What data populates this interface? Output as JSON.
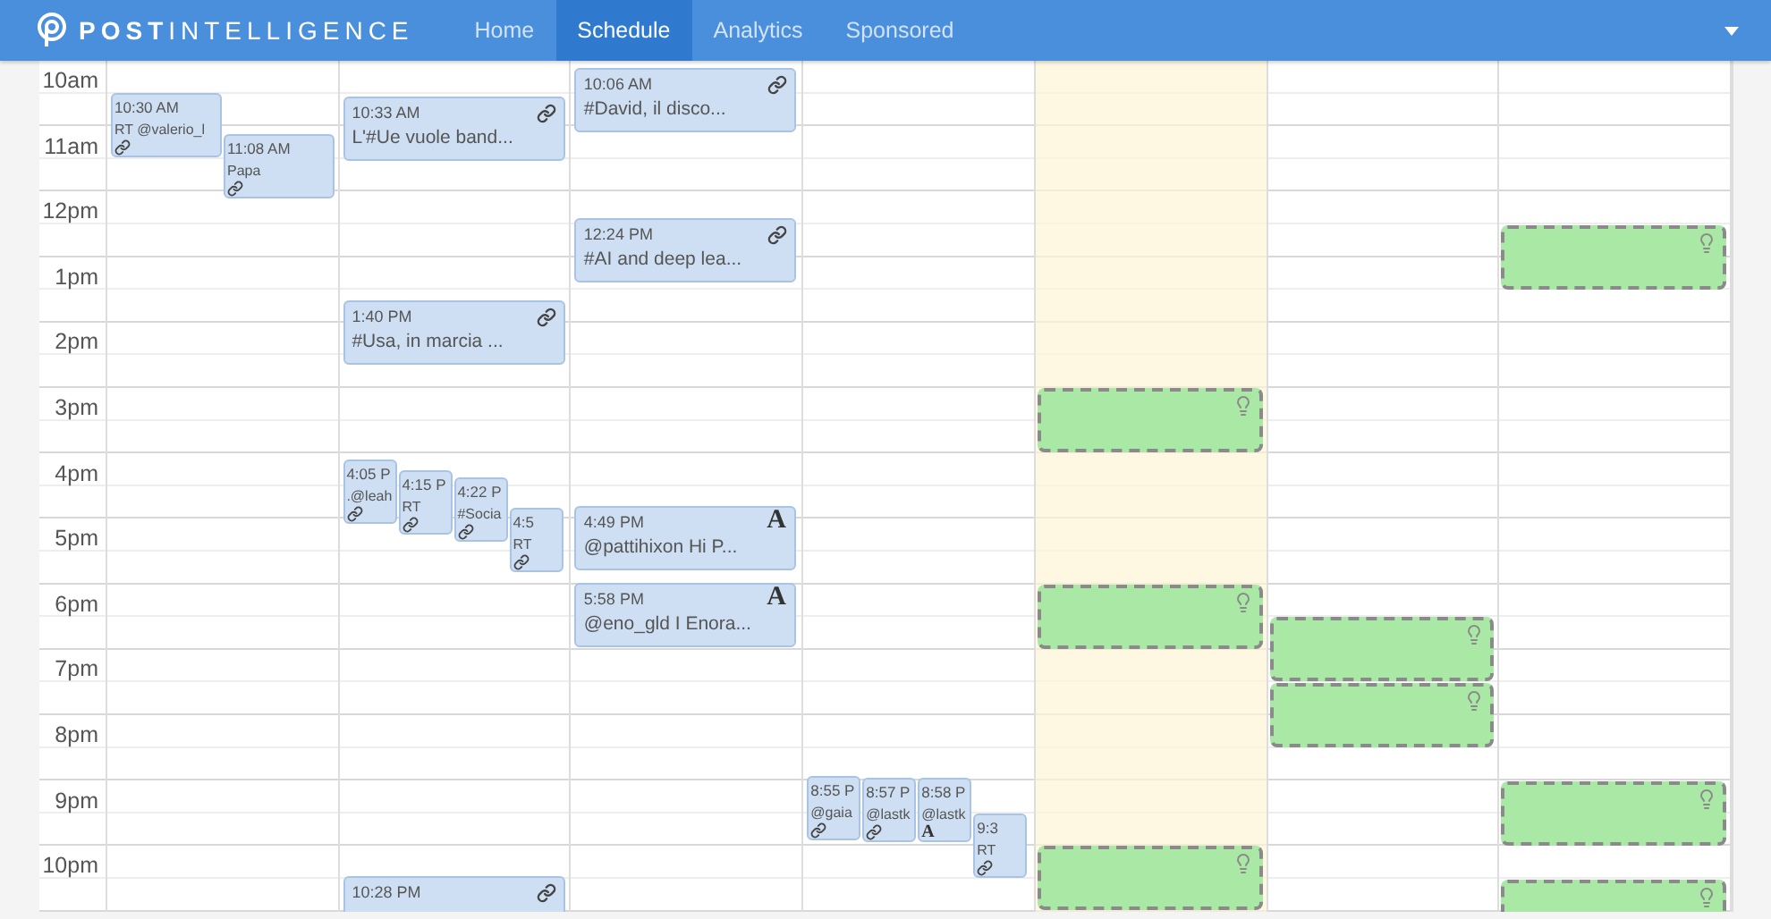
{
  "navbar": {
    "logo": "**POST**INTELLIGENCE",
    "items": [
      {
        "label": "Home",
        "selected": false
      },
      {
        "label": "Schedule",
        "selected": true
      },
      {
        "label": "Analytics",
        "selected": false
      },
      {
        "label": "Sponsored",
        "selected": false
      }
    ]
  },
  "days": [
    {
      "today": false
    },
    {
      "today": false
    },
    {
      "today": false
    },
    {
      "today": false
    },
    {
      "today": true
    },
    {
      "today": false
    },
    {
      "today": false
    }
  ],
  "rows": [
    {
      "label": "10am",
      "cells": [
        {
          "events": [
            {
              "time": "10:30 AM",
              "text": "RT @valerio_l",
              "kind": "link"
            }
          ]
        },
        {
          "events": [
            {
              "time": "10:33 AM",
              "text": "L'#Ue vuole band...",
              "kind": "link"
            }
          ]
        },
        {
          "events": [
            {
              "time": "10:06 AM",
              "text": "#David, il disco...",
              "kind": "link"
            }
          ]
        },
        {},
        {},
        {},
        {}
      ]
    },
    {
      "label": "11am",
      "cells": [
        {
          "events": [
            {
              "time": "11:08 AM",
              "text": "Papa",
              "kind": "link"
            }
          ]
        },
        {},
        {},
        {},
        {},
        {},
        {}
      ]
    },
    {
      "label": "12pm",
      "cells": [
        {},
        {},
        {
          "events": [
            {
              "time": "12:24 PM",
              "text": "#AI and deep lea...",
              "kind": "link"
            }
          ]
        },
        {},
        {},
        {},
        {
          "suggested": true,
          "half_past": true
        }
      ]
    },
    {
      "label": "1pm",
      "cells": [
        {},
        {
          "events": [
            {
              "time": "1:40 PM",
              "text": "#Usa, in marcia ...",
              "kind": "link"
            }
          ]
        },
        {},
        {},
        {},
        {},
        {}
      ]
    },
    {
      "label": "2pm",
      "cells": [
        {},
        {},
        {},
        {},
        {},
        {},
        {}
      ]
    },
    {
      "label": "3pm",
      "cells": [
        {},
        {},
        {},
        {},
        {
          "suggested": true,
          "half_past": false
        },
        {},
        {}
      ]
    },
    {
      "label": "4pm",
      "cells": [
        {},
        {
          "events": [
            {
              "time": "4:05 P",
              "text": ".@leah",
              "kind": "link"
            },
            {
              "time": "4:15 P",
              "text": "RT",
              "kind": "link"
            },
            {
              "time": "4:22 P",
              "text": "#Socia",
              "kind": "link"
            },
            {
              "time": "4:5",
              "text": "RT",
              "kind": "link"
            }
          ]
        },
        {
          "events": [
            {
              "time": "4:49 PM",
              "text": "@pattihixon Hi P...",
              "kind": "font",
              "glyph": "A"
            }
          ]
        },
        {},
        {},
        {},
        {}
      ]
    },
    {
      "label": "5pm",
      "cells": [
        {},
        {},
        {
          "events": [
            {
              "time": "5:58 PM",
              "text": "@eno_gld I Enora...",
              "kind": "font",
              "glyph": "A"
            }
          ]
        },
        {},
        {},
        {},
        {}
      ]
    },
    {
      "label": "6pm",
      "cells": [
        {},
        {},
        {},
        {},
        {
          "suggested": true,
          "half_past": false
        },
        {
          "suggested": true,
          "half_past": true
        },
        {}
      ]
    },
    {
      "label": "7pm",
      "cells": [
        {},
        {},
        {},
        {},
        {},
        {
          "suggested": true,
          "half_past": true
        },
        {}
      ]
    },
    {
      "label": "8pm",
      "cells": [
        {},
        {},
        {},
        {
          "events": [
            {
              "time": "8:55 P",
              "text": "@gaia",
              "kind": "link"
            },
            {
              "time": "8:57 P",
              "text": "@lastk",
              "kind": "link"
            },
            {
              "time": "8:58 P",
              "text": "@lastk",
              "kind": "font",
              "glyph": "A"
            }
          ]
        },
        {},
        {},
        {}
      ]
    },
    {
      "label": "9pm",
      "cells": [
        {},
        {},
        {},
        {
          "events": [
            {
              "time": "9:3",
              "text": "RT",
              "kind": "link"
            }
          ]
        },
        {},
        {},
        {
          "suggested": true,
          "half_past": false
        }
      ]
    },
    {
      "label": "10pm",
      "cells": [
        {},
        {
          "events": [
            {
              "time": "10:28 PM",
              "kind": "link"
            }
          ]
        },
        {},
        {},
        {
          "suggested": true,
          "half_past": false
        },
        {},
        {
          "suggested": true,
          "half_past": true
        }
      ]
    }
  ]
}
